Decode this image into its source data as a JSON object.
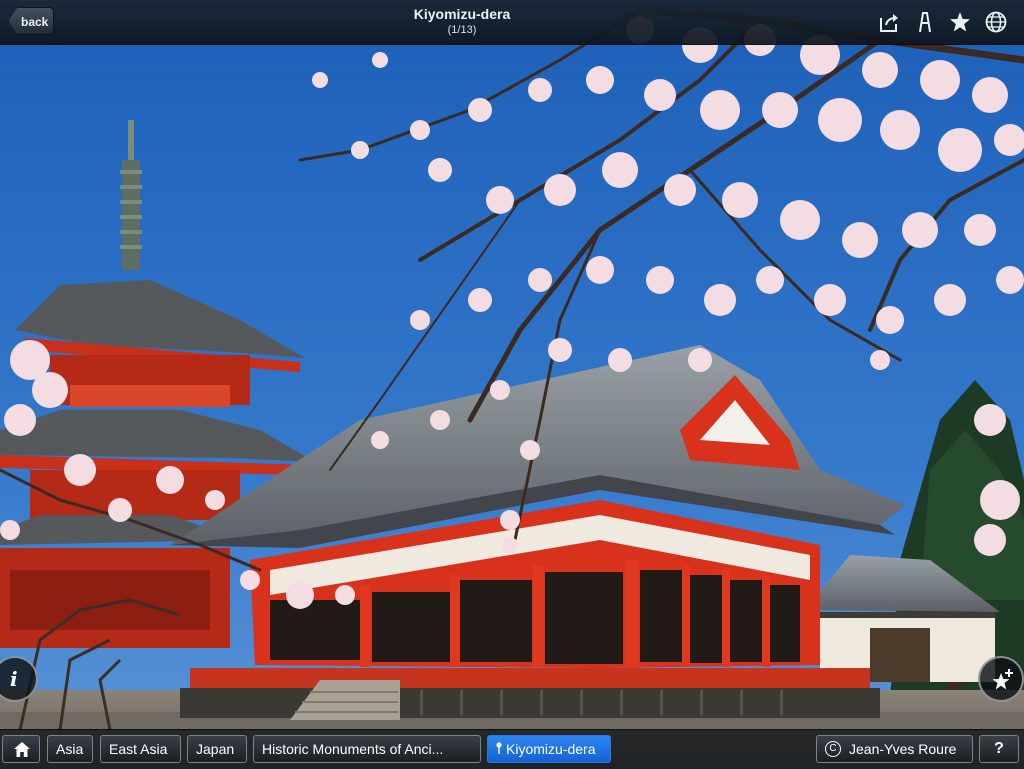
{
  "header": {
    "back_label": "back",
    "title": "Kiyomizu-dera",
    "page_counter": "(1/13)",
    "text_icon_glyph": "A",
    "icons": [
      "share-icon",
      "text-size-icon",
      "star-icon",
      "globe-icon"
    ]
  },
  "side_buttons": {
    "info_glyph": "i",
    "info_icon": "info-icon",
    "favorite_icon": "star-plus-icon"
  },
  "breadcrumb": {
    "home_icon": "home-icon",
    "items": [
      "Asia",
      "East Asia",
      "Japan",
      "Historic Monuments of Anci..."
    ],
    "current": "Kiyomizu-dera",
    "current_icon": "location-pin-icon"
  },
  "footer": {
    "credit": "Jean-Yves Roure",
    "credit_icon": "copyright-icon",
    "help_label": "?"
  },
  "colors": {
    "sky": "#2a6fc4",
    "temple_red": "#d8321c",
    "roof": "#6f7478",
    "blossom": "#f3dde3",
    "active_crumb": "#1f74e6"
  }
}
